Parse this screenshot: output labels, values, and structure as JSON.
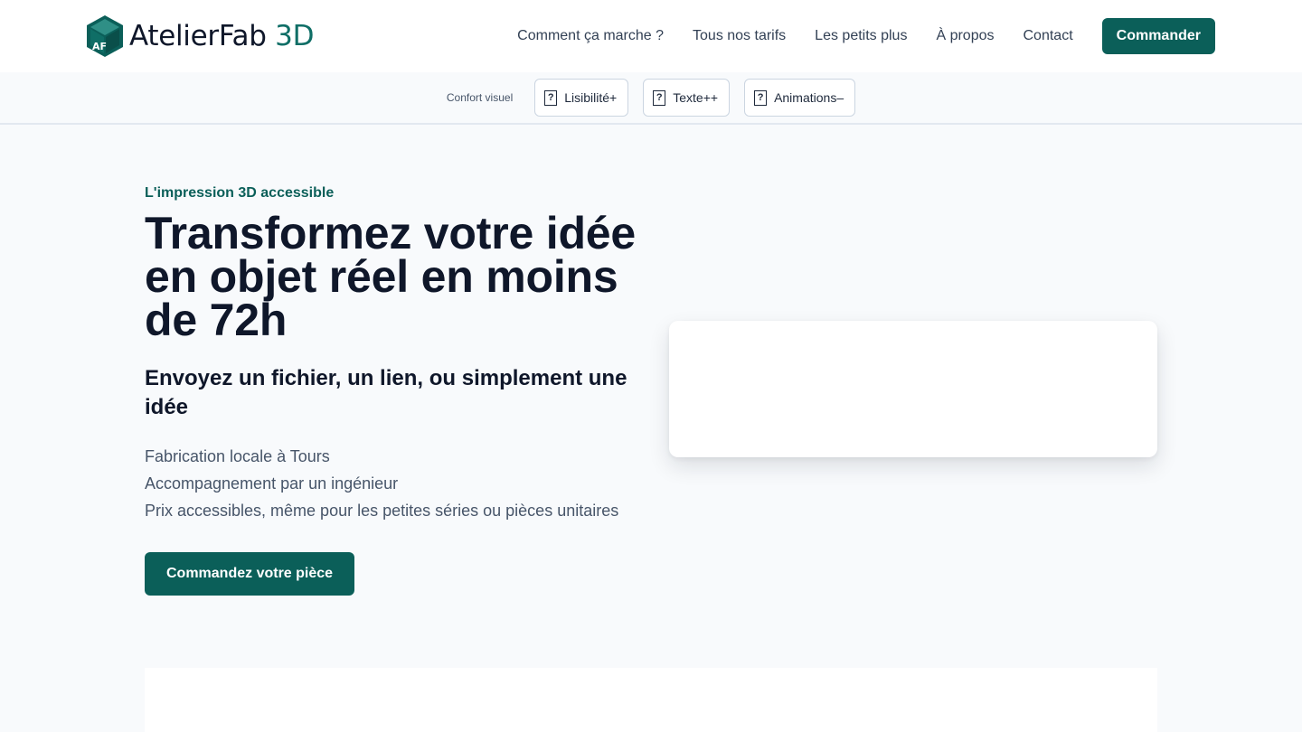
{
  "brand": {
    "name_main": "AtelierFab",
    "name_accent": "3D",
    "logo_mark_letters": "AF",
    "accent_color": "#0b5f59"
  },
  "nav": {
    "items": [
      {
        "label": "Comment ça marche ?"
      },
      {
        "label": "Tous nos tarifs"
      },
      {
        "label": "Les petits plus"
      },
      {
        "label": "À propos"
      },
      {
        "label": "Contact"
      }
    ],
    "cta_label": "Commander"
  },
  "comfort": {
    "label": "Confort visuel",
    "buttons": [
      {
        "icon": "help-box-icon",
        "icon_glyph": "?",
        "label": "Lisibilité+"
      },
      {
        "icon": "help-box-icon",
        "icon_glyph": "?",
        "label": "Texte++"
      },
      {
        "icon": "help-box-icon",
        "icon_glyph": "?",
        "label": "Animations–"
      }
    ]
  },
  "hero": {
    "eyebrow": "L'impression 3D accessible",
    "title": "Transformez votre idée en objet réel en moins de 72h",
    "subtitle": "Envoyez un fichier, un lien, ou simplement une idée",
    "features": [
      "Fabrication locale à Tours",
      "Accompagnement par un ingénieur",
      "Prix accessibles, même pour les petites séries ou pièces unitaires"
    ],
    "cta_label": "Commandez votre pièce"
  }
}
